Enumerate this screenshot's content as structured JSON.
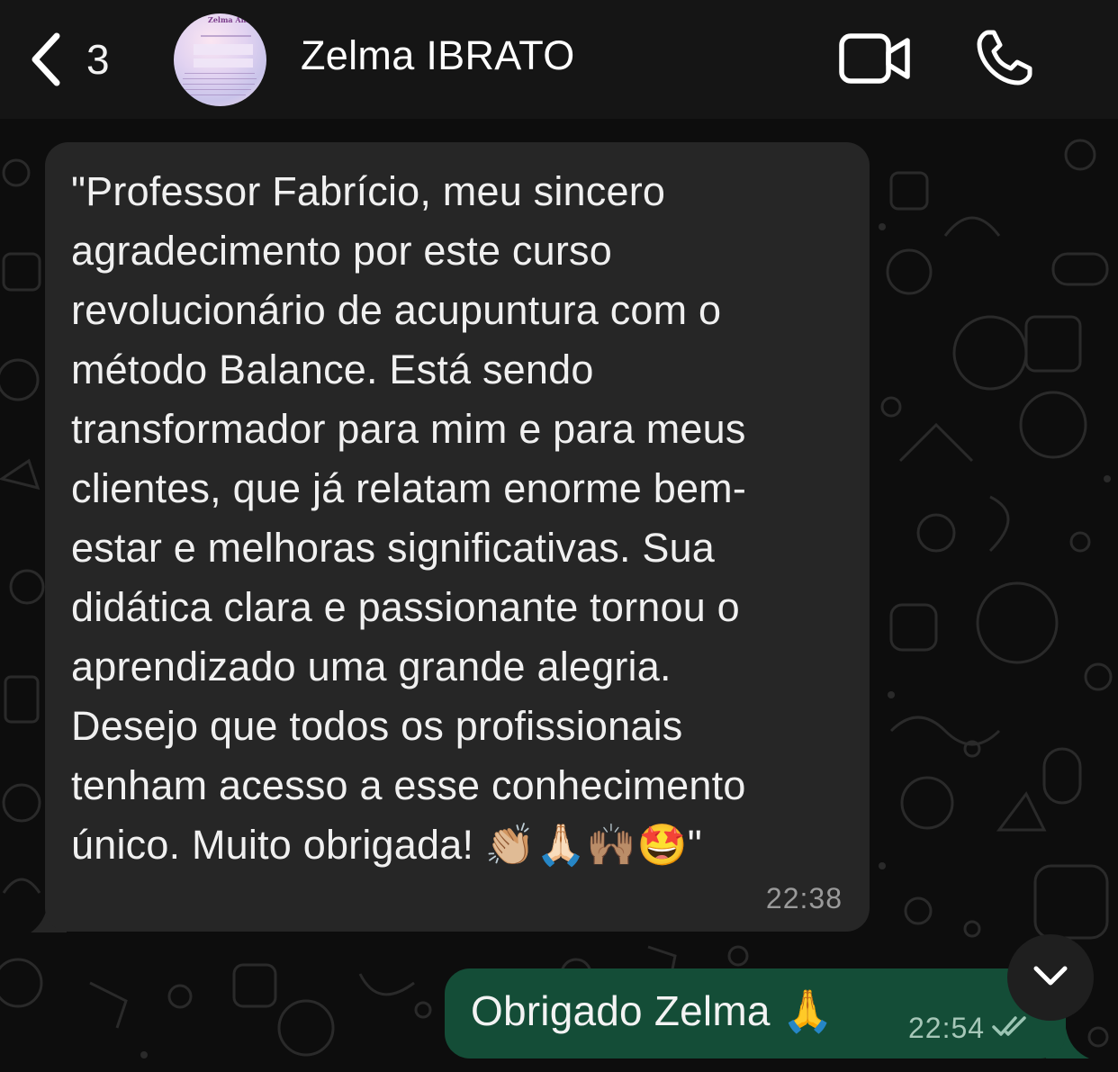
{
  "header": {
    "back_count": "3",
    "contact_name": "Zelma IBRATO",
    "avatar_text": "Zelma Amora"
  },
  "icons": {
    "back": "chevron-left-icon",
    "video": "video-camera-icon",
    "call": "phone-icon",
    "scroll": "chevron-down-icon",
    "read_receipt": "double-check-icon"
  },
  "messages": [
    {
      "direction": "incoming",
      "text": "\"Professor Fabrício, meu sincero\nagradecimento por este curso\nrevolucionário de acupuntura com o\nmétodo Balance. Está sendo\ntransformador para mim e para meus\nclientes, que já relatam enorme bem-\nestar e melhoras significativas. Sua\ndidática clara e passionante tornou o\naprendizado uma grande alegria.\nDesejo que todos os profissionais\ntenham acesso a esse conhecimento\núnico. Muito obrigada! 👏🏼🙏🏻🙌🏽🤩\"",
      "time": "22:38"
    },
    {
      "direction": "outgoing",
      "text": "Obrigado Zelma 🙏",
      "time": "22:54",
      "status": "read"
    }
  ],
  "colors": {
    "header_bg": "#151515",
    "chat_bg": "#0d0d0d",
    "incoming_bubble": "#262626",
    "outgoing_bubble": "#144d37",
    "read_ticks": "#9cc5b4"
  }
}
